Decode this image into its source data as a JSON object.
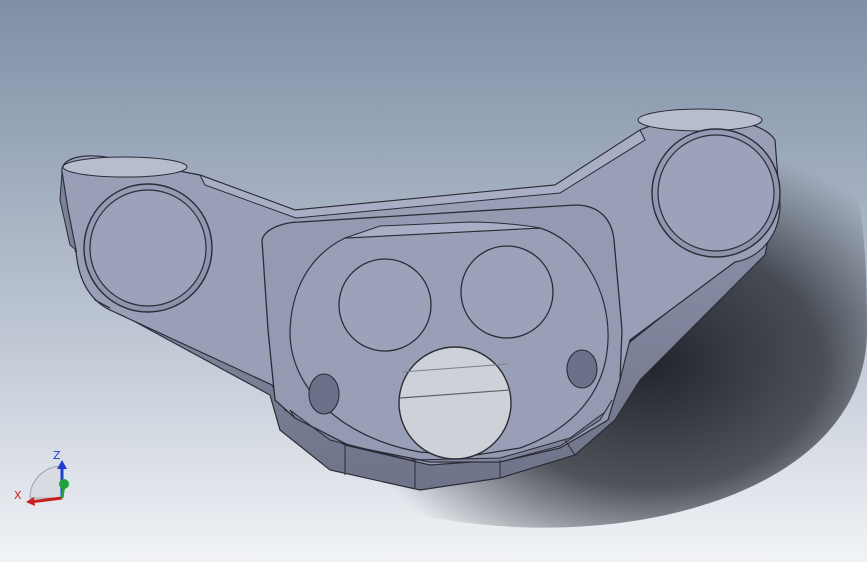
{
  "viewport": {
    "background_top": "#7f8fa6",
    "background_bottom": "#f1f3f6",
    "shadow_color": "#1a1d22"
  },
  "model": {
    "face_color": "#9a9fb8",
    "face_light": "#a9aec6",
    "side_color": "#7e8298",
    "edge_color": "#2a2c36",
    "pin_color": "#cfd1d8"
  },
  "triad": {
    "x_label": "X",
    "z_label": "Z",
    "x_color": "#c81e1e",
    "y_color": "#1fa33a",
    "z_color": "#1f3fd0"
  }
}
